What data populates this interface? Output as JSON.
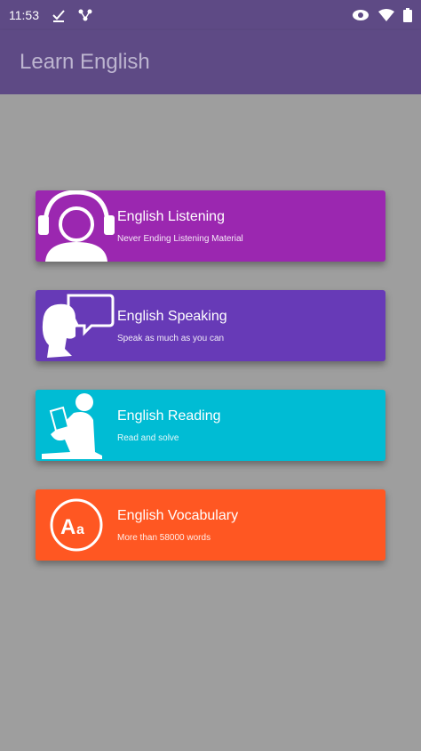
{
  "status_bar": {
    "time": "11:53",
    "icons": [
      "check-download-icon",
      "network-share-icon",
      "eye-icon",
      "wifi-icon",
      "battery-icon"
    ]
  },
  "app_bar": {
    "title": "Learn English"
  },
  "colors": {
    "app_bar": "#5e4a85",
    "background": "#9e9e9e",
    "listening": "#9b27b0",
    "speaking": "#673ab7",
    "reading": "#00bcd4",
    "vocabulary": "#ff5722"
  },
  "cards": [
    {
      "title": "English Listening",
      "subtitle": "Never Ending Listening Material",
      "icon": "headphones-person-icon"
    },
    {
      "title": "English Speaking",
      "subtitle": "Speak as much as you can",
      "icon": "speaking-head-icon"
    },
    {
      "title": "English Reading",
      "subtitle": "Read and solve",
      "icon": "reading-person-icon"
    },
    {
      "title": "English Vocabulary",
      "subtitle": "More than 58000 words",
      "icon": "aa-letters-icon"
    }
  ]
}
